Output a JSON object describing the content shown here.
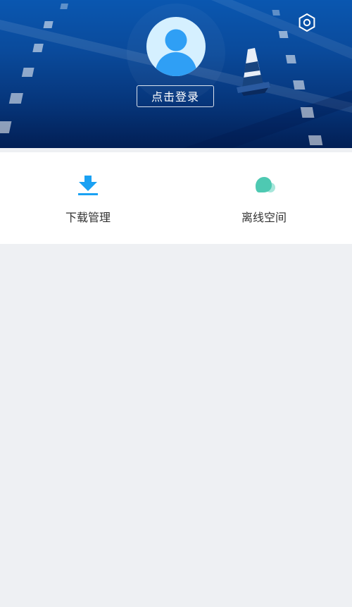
{
  "header": {
    "login_label": "点击登录",
    "settings_icon": "settings-icon",
    "avatar_icon": "default-avatar-icon",
    "colors": {
      "bg_top": "#0a57b0",
      "bg_bottom": "#021f55",
      "avatar_bg": "#d5f0ff",
      "avatar_fg": "#2f9ff5"
    }
  },
  "quick_actions": [
    {
      "label": "下载管理",
      "icon": "download-icon",
      "color": "#1aa1f3"
    },
    {
      "label": "离线空间",
      "icon": "cloud-icon",
      "color": "#4ec9b2"
    }
  ]
}
